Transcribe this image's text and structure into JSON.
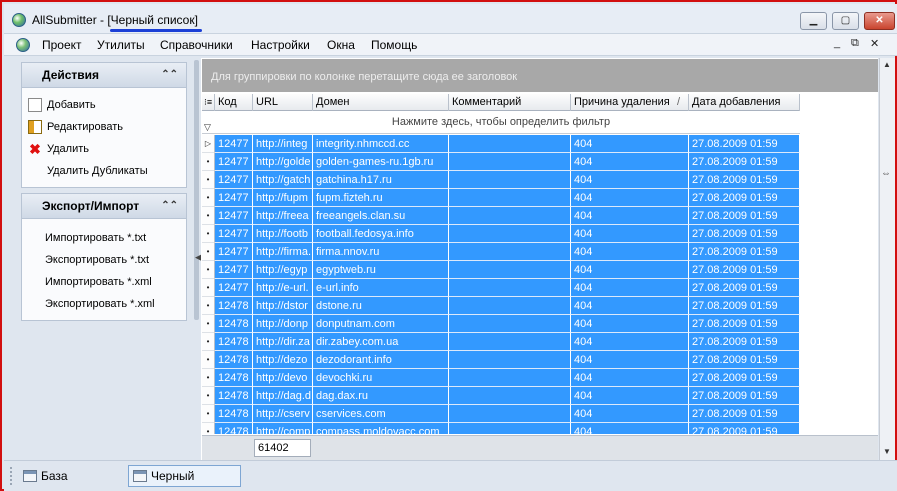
{
  "window": {
    "title": "AllSubmitter - [Черный список]",
    "controls": {
      "minimize": "▁",
      "maximize": "▢",
      "close": "✕"
    }
  },
  "menu": {
    "items": [
      "Проект",
      "Утилиты",
      "Справочники",
      "Настройки",
      "Окна",
      "Помощь"
    ],
    "mdi_controls": [
      "_",
      "⧉",
      "✕"
    ]
  },
  "sidebar": {
    "actions": {
      "title": "Действия",
      "items": [
        {
          "label": "Добавить",
          "icon": "new-page-icon"
        },
        {
          "label": "Редактировать",
          "icon": "edit-icon"
        },
        {
          "label": "Удалить",
          "icon": "delete-icon"
        },
        {
          "label": "Удалить Дубликаты",
          "icon": ""
        }
      ]
    },
    "export_import": {
      "title": "Экспорт/Импорт",
      "items": [
        {
          "label": "Импортировать *.txt"
        },
        {
          "label": "Экспортировать *.txt"
        },
        {
          "label": "Импортировать *.xml"
        },
        {
          "label": "Экспортировать *.xml"
        }
      ]
    }
  },
  "grid": {
    "group_hint": "Для группировки по колонке перетащите сюда ее заголовок",
    "filter_hint": "Нажмите здесь, чтобы определить фильтр",
    "columns": [
      "Код",
      "URL",
      "Домен",
      "Комментарий",
      "Причина удаления",
      "Дата добавления"
    ],
    "sort_indicator": "/",
    "rows": [
      [
        "12477",
        "http://integ",
        "integrity.nhmccd.cc",
        "",
        "404",
        "27.08.2009 01:59"
      ],
      [
        "12477",
        "http://golde",
        "golden-games-ru.1gb.ru",
        "",
        "404",
        "27.08.2009 01:59"
      ],
      [
        "12477",
        "http://gatch",
        "gatchina.h17.ru",
        "",
        "404",
        "27.08.2009 01:59"
      ],
      [
        "12477",
        "http://fupm",
        "fupm.fizteh.ru",
        "",
        "404",
        "27.08.2009 01:59"
      ],
      [
        "12477",
        "http://freea",
        "freeangels.clan.su",
        "",
        "404",
        "27.08.2009 01:59"
      ],
      [
        "12477",
        "http://footb",
        "football.fedosya.info",
        "",
        "404",
        "27.08.2009 01:59"
      ],
      [
        "12477",
        "http://firma.",
        "firma.nnov.ru",
        "",
        "404",
        "27.08.2009 01:59"
      ],
      [
        "12477",
        "http://egyp",
        "egyptweb.ru",
        "",
        "404",
        "27.08.2009 01:59"
      ],
      [
        "12477",
        "http://e-url.",
        "e-url.info",
        "",
        "404",
        "27.08.2009 01:59"
      ],
      [
        "12478",
        "http://dstor",
        "dstone.ru",
        "",
        "404",
        "27.08.2009 01:59"
      ],
      [
        "12478",
        "http://donp",
        "donputnam.com",
        "",
        "404",
        "27.08.2009 01:59"
      ],
      [
        "12478",
        "http://dir.za",
        "dir.zabey.com.ua",
        "",
        "404",
        "27.08.2009 01:59"
      ],
      [
        "12478",
        "http://dezo",
        "dezodorant.info",
        "",
        "404",
        "27.08.2009 01:59"
      ],
      [
        "12478",
        "http://devo",
        "devochki.ru",
        "",
        "404",
        "27.08.2009 01:59"
      ],
      [
        "12478",
        "http://dag.d",
        "dag.dax.ru",
        "",
        "404",
        "27.08.2009 01:59"
      ],
      [
        "12478",
        "http://cserv",
        "cservices.com",
        "",
        "404",
        "27.08.2009 01:59"
      ],
      [
        "12478",
        "http://comp",
        "compass.moldovacc.com",
        "",
        "404",
        "27.08.2009 01:59"
      ]
    ],
    "row_count": "61402"
  },
  "tabs": [
    {
      "label": "База каталогов",
      "active": false
    },
    {
      "label": "Черный список",
      "active": true
    }
  ],
  "colors": {
    "selection": "#3399ff",
    "frame": "#d20f0f",
    "annotation_underline": "#1b3fd6"
  }
}
